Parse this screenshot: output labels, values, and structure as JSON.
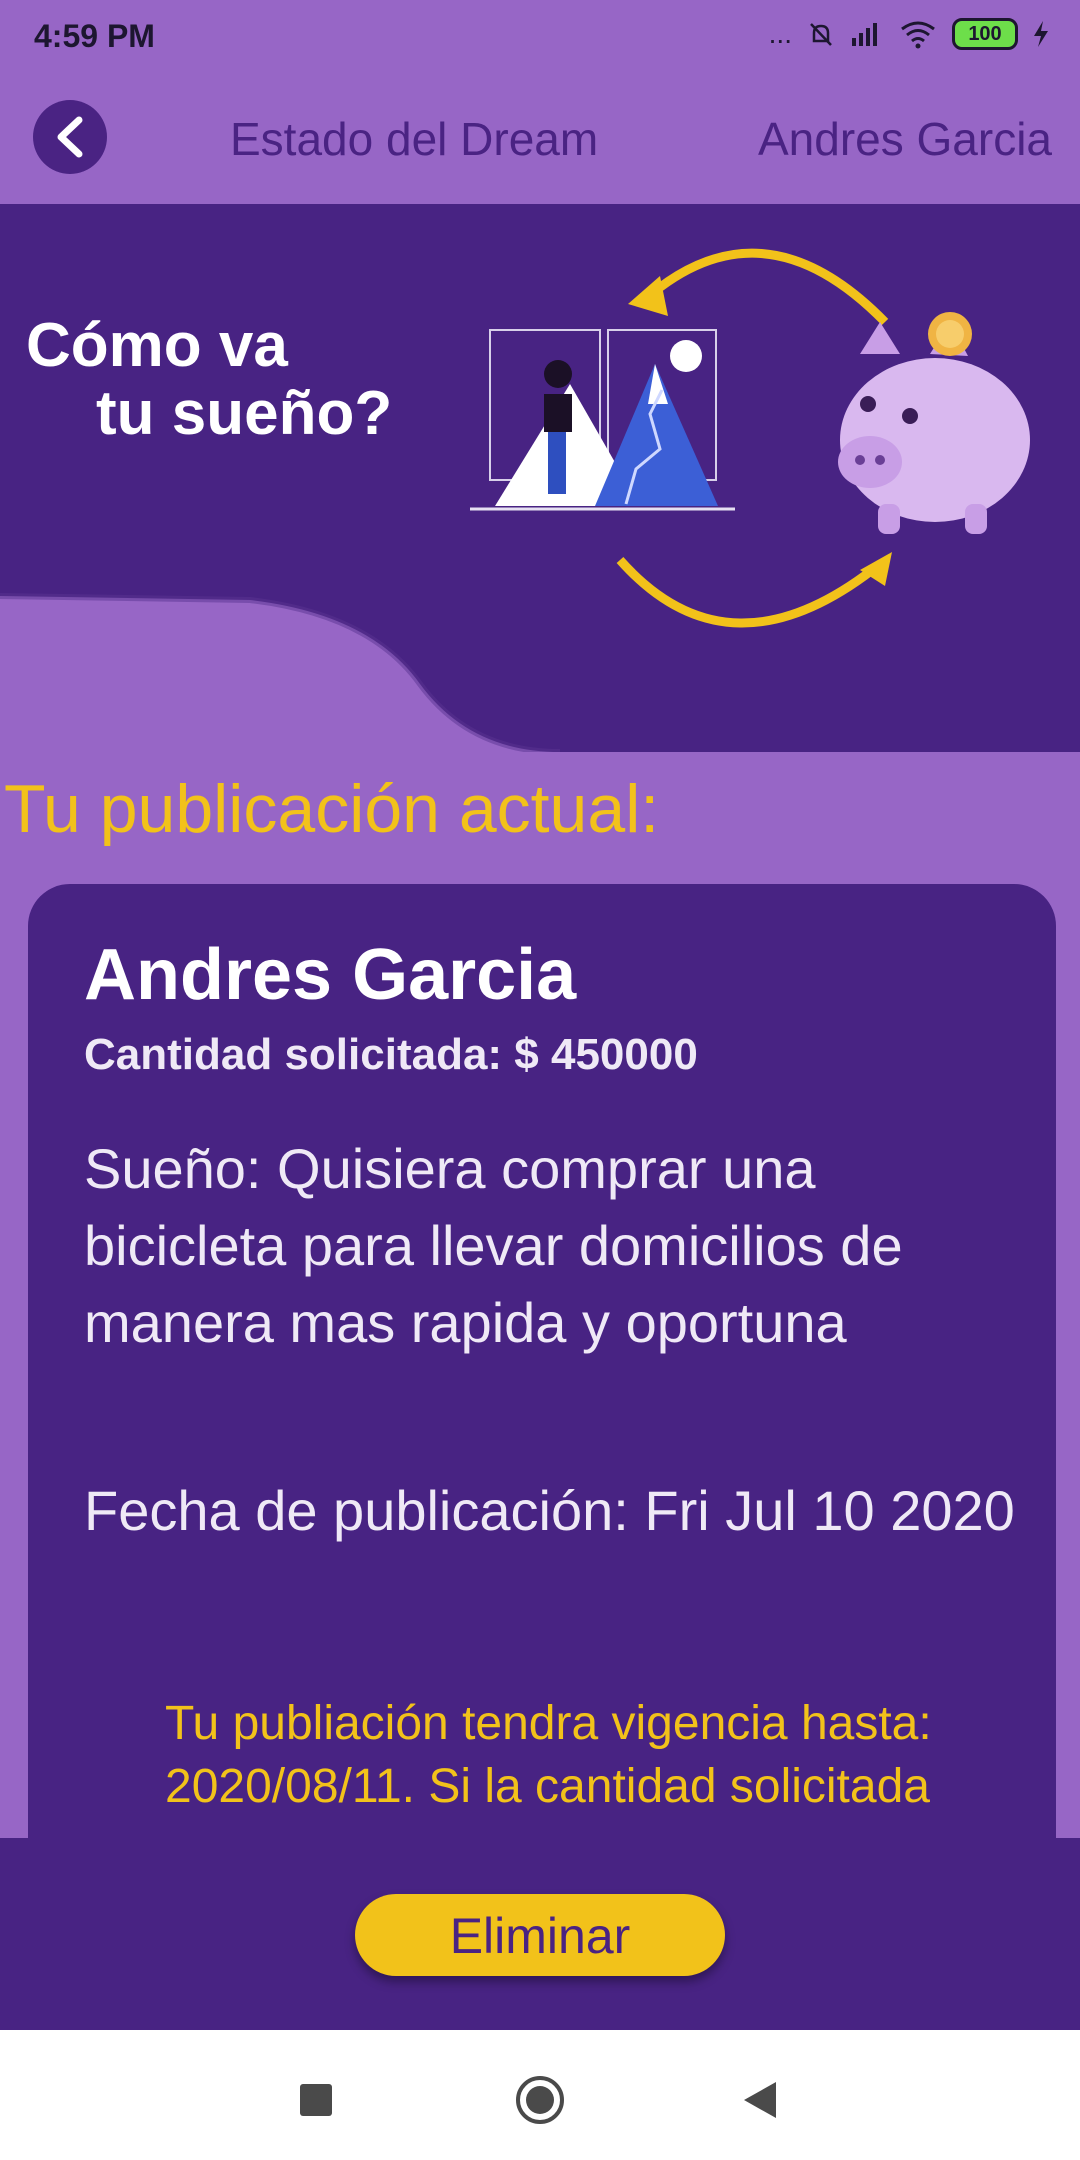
{
  "status_bar": {
    "time": "4:59 PM",
    "dots": "...",
    "battery": "100"
  },
  "header": {
    "title": "Estado del Dream",
    "user_name": "Andres Garcia"
  },
  "banner": {
    "line1": "Cómo va",
    "line2": "tu sueño?"
  },
  "section_title": "Tu publicación actual:",
  "card": {
    "name": "Andres Garcia",
    "amount": "Cantidad solicitada: $ 450000",
    "dream": "Sueño: Quisiera comprar una bicicleta para llevar domicilios de manera mas rapida y oportuna",
    "date": "Fecha de publicación: Fri Jul 10 2020",
    "notice": "Tu publiación tendra vigencia hasta: 2020/08/11. Si la cantidad solicitada"
  },
  "actions": {
    "delete_label": "Eliminar"
  },
  "colors": {
    "background": "#9766c6",
    "primary": "#482383",
    "accent": "#f2c21a"
  }
}
